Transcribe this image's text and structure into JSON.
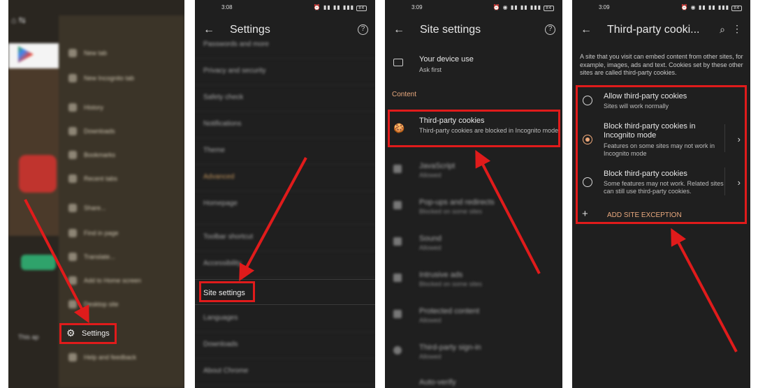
{
  "colors": {
    "highlight": "#e01b1b",
    "accent": "#f0a97a",
    "panel_bg": "#1f1f1f"
  },
  "panel1": {
    "menu_items": [
      "New tab",
      "New Incognito tab",
      "History",
      "Downloads",
      "Bookmarks",
      "Recent tabs",
      "Share...",
      "Find in page",
      "Translate...",
      "Add to Home screen",
      "Desktop site"
    ],
    "settings_label": "Settings",
    "help_label": "Help and feedback",
    "bottom_text": "This ap"
  },
  "panel2": {
    "time": "3:08",
    "title": "Settings",
    "blurred_rows": [
      "Passwords and more",
      "Privacy and security",
      "Safety check",
      "Notifications",
      "Theme",
      "Advanced",
      "Homepage",
      "Toolbar shortcut",
      "Accessibility"
    ],
    "site_settings_label": "Site settings",
    "rows_after": [
      "Languages",
      "Downloads",
      "About Chrome"
    ]
  },
  "panel3": {
    "time": "3:09",
    "title": "Site settings",
    "device_title": "Your device use",
    "device_subtitle": "Ask first",
    "section": "Content",
    "cookies_title": "Third-party cookies",
    "cookies_subtitle": "Third-party cookies are blocked in Incognito mode",
    "blurred_rows": [
      {
        "t": "JavaScript",
        "s": "Allowed"
      },
      {
        "t": "Pop-ups and redirects",
        "s": "Blocked on some sites"
      },
      {
        "t": "Sound",
        "s": "Allowed"
      },
      {
        "t": "Intrusive ads",
        "s": "Blocked on some sites"
      },
      {
        "t": "Protected content",
        "s": "Allowed"
      },
      {
        "t": "Third-party sign-in",
        "s": "Allowed"
      },
      {
        "t": "Auto-verify",
        "s": ""
      }
    ]
  },
  "panel4": {
    "time": "3:09",
    "title": "Third-party cooki...",
    "description": "A site that you visit can embed content from other sites, for example, images, ads and text. Cookies set by these other sites are called third-party cookies.",
    "options": [
      {
        "title": "Allow third-party cookies",
        "subtitle": "Sites will work normally",
        "selected": false
      },
      {
        "title": "Block third-party cookies in Incognito mode",
        "subtitle": "Features on some sites may not work in Incognito mode",
        "selected": true
      },
      {
        "title": "Block third-party cookies",
        "subtitle": "Some features may not work. Related sites can still use third-party cookies.",
        "selected": false
      }
    ],
    "add_exception": "ADD SITE EXCEPTION"
  }
}
